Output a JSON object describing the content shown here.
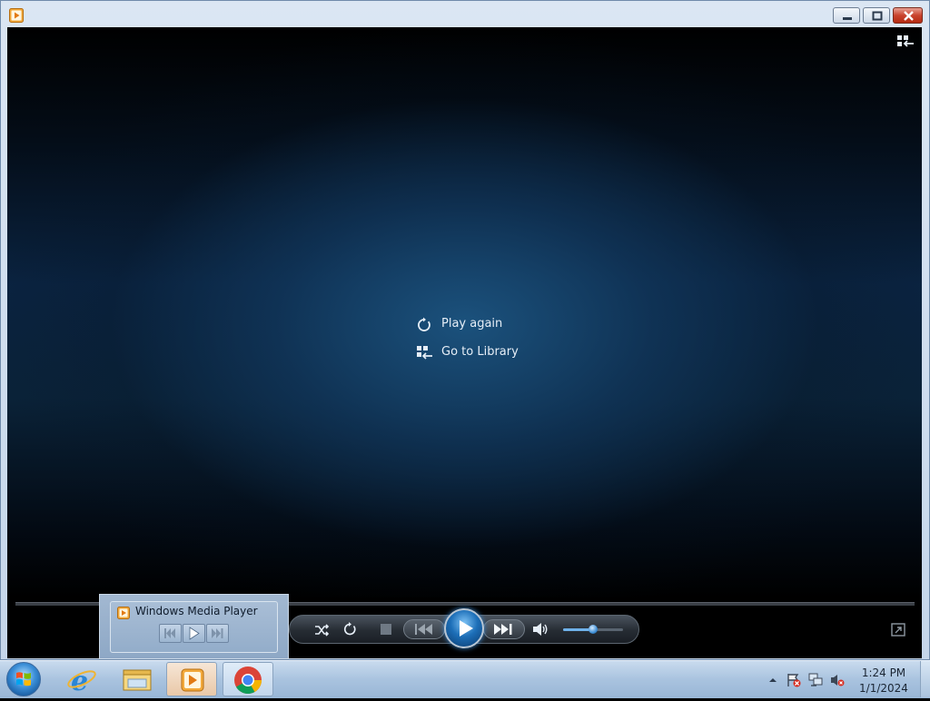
{
  "window": {
    "app_icon": "media-player-icon",
    "buttons": {
      "minimize": "minimize-icon",
      "maximize": "maximize-icon",
      "close": "close-icon"
    }
  },
  "player": {
    "menu": {
      "play_again_label": "Play again",
      "go_to_library_label": "Go to Library"
    },
    "icons": {
      "switch_to_library": "switch-to-library-icon",
      "shuffle": "shuffle-icon",
      "repeat": "repeat-icon",
      "stop": "stop-icon",
      "previous": "previous-icon",
      "play": "play-icon",
      "next": "next-icon",
      "volume": "speaker-icon",
      "switch_to_now_playing": "switch-to-now-playing-icon"
    },
    "volume_level": 0.5
  },
  "thumbnail": {
    "title": "Windows Media Player",
    "buttons": [
      "previous-icon",
      "play-icon",
      "next-icon"
    ]
  },
  "taskbar": {
    "items": [
      "internet-explorer-icon",
      "file-explorer-icon",
      "windows-media-player-icon",
      "chrome-icon"
    ],
    "tray": [
      "show-hidden-icons-icon",
      "action-center-icon",
      "network-icon",
      "volume-muted-icon"
    ],
    "time": "1:24 PM",
    "date": "1/1/2024"
  },
  "colors": {
    "video_background": "#0a2340",
    "accent_blue": "#1d6fb8",
    "close_red": "#c9432d",
    "taskbar": "#a9c3df"
  }
}
